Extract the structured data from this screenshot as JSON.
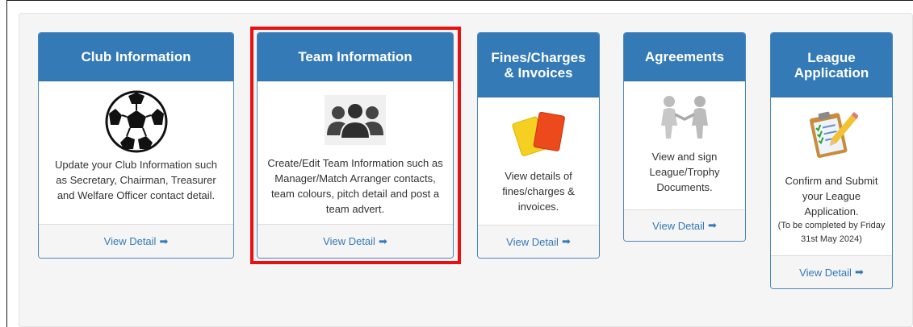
{
  "cards": [
    {
      "title": "Club Information",
      "description": "Update your Club Information such as Secretary, Chairman, Treasurer and Welfare Officer contact detail.",
      "link": "View Detail",
      "icon": "soccer-ball-icon"
    },
    {
      "title": "Team Information",
      "description": "Create/Edit Team Information such as Manager/Match Arranger contacts, team colours, pitch detail and post a team advert.",
      "link": "View Detail",
      "icon": "team-people-icon"
    },
    {
      "title": "Fines/Charges & Invoices",
      "description": "View details of fines/charges & invoices.",
      "link": "View Detail",
      "icon": "penalty-cards-icon"
    },
    {
      "title": "Agreements",
      "description": "View and sign League/Trophy Documents.",
      "link": "View Detail",
      "icon": "handshake-icon"
    },
    {
      "title": "League Application",
      "description": "Confirm and Submit your League Application.",
      "note": "(To be completed by Friday 31st May 2024)",
      "link": "View Detail",
      "icon": "clipboard-checklist-icon"
    }
  ],
  "colors": {
    "header_bg": "#337ab7",
    "link": "#337ab7",
    "highlight": "#e81010"
  }
}
